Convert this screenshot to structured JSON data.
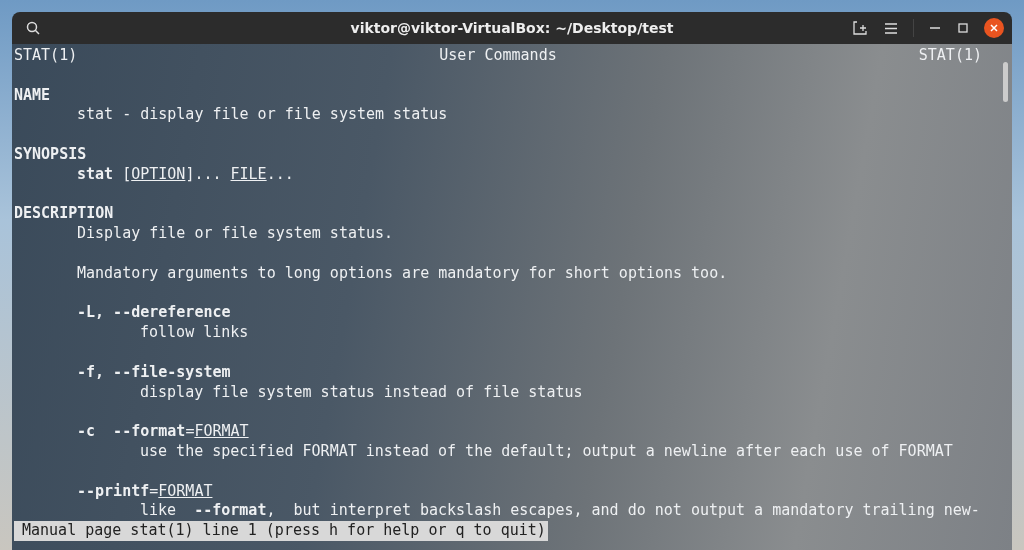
{
  "window": {
    "title": "viktor@viktor-VirtualBox: ~/Desktop/test"
  },
  "header": {
    "left": "STAT(1)",
    "center": "User Commands",
    "right": "STAT(1)"
  },
  "lines": [
    {
      "kind": "blank"
    },
    {
      "kind": "heading",
      "segments": [
        {
          "text": "NAME",
          "kind": "text"
        }
      ]
    },
    {
      "kind": "body",
      "segments": [
        {
          "text": "stat - display file or file system status",
          "kind": "text"
        }
      ]
    },
    {
      "kind": "blank"
    },
    {
      "kind": "heading",
      "segments": [
        {
          "text": "SYNOPSIS",
          "kind": "text"
        }
      ]
    },
    {
      "kind": "body",
      "segments": [
        {
          "text": "stat",
          "kind": "command"
        },
        {
          "text": " [",
          "kind": "text"
        },
        {
          "text": "OPTION",
          "kind": "argument"
        },
        {
          "text": "]... ",
          "kind": "text"
        },
        {
          "text": "FILE",
          "kind": "argument"
        },
        {
          "text": "...",
          "kind": "text"
        }
      ]
    },
    {
      "kind": "blank"
    },
    {
      "kind": "heading",
      "segments": [
        {
          "text": "DESCRIPTION",
          "kind": "text"
        }
      ]
    },
    {
      "kind": "body",
      "segments": [
        {
          "text": "Display file or file system status.",
          "kind": "text"
        }
      ]
    },
    {
      "kind": "blank"
    },
    {
      "kind": "body",
      "segments": [
        {
          "text": "Mandatory arguments to long options are mandatory for short options too.",
          "kind": "text"
        }
      ]
    },
    {
      "kind": "blank"
    },
    {
      "kind": "body",
      "segments": [
        {
          "text": "-L, --dereference",
          "kind": "command"
        }
      ]
    },
    {
      "kind": "detail",
      "segments": [
        {
          "text": "follow links",
          "kind": "text"
        }
      ]
    },
    {
      "kind": "blank"
    },
    {
      "kind": "body",
      "segments": [
        {
          "text": "-f, --file-system",
          "kind": "command"
        }
      ]
    },
    {
      "kind": "detail",
      "segments": [
        {
          "text": "display file system status instead of file status",
          "kind": "text"
        }
      ]
    },
    {
      "kind": "blank"
    },
    {
      "kind": "body",
      "segments": [
        {
          "text": "-c  --format",
          "kind": "command"
        },
        {
          "text": "=",
          "kind": "text"
        },
        {
          "text": "FORMAT",
          "kind": "argument"
        }
      ]
    },
    {
      "kind": "detail",
      "segments": [
        {
          "text": "use the specified FORMAT instead of the default; output a newline after each use of FORMAT",
          "kind": "text"
        }
      ]
    },
    {
      "kind": "blank"
    },
    {
      "kind": "body",
      "segments": [
        {
          "text": "--printf",
          "kind": "command"
        },
        {
          "text": "=",
          "kind": "text"
        },
        {
          "text": "FORMAT",
          "kind": "argument"
        }
      ]
    },
    {
      "kind": "detail",
      "segments": [
        {
          "text": "like  ",
          "kind": "text"
        },
        {
          "text": "--format",
          "kind": "command"
        },
        {
          "text": ",  but interpret backslash escapes, and do not output a mandatory trailing new-",
          "kind": "text"
        }
      ]
    }
  ],
  "status_line": "Manual page stat(1) line 1 (press h for help or q to quit)"
}
